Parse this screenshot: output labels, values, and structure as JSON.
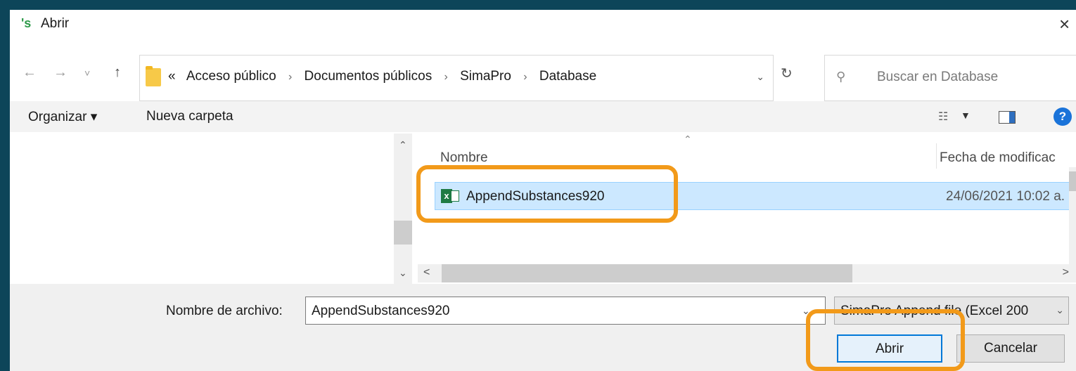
{
  "window": {
    "app_icon": "'s",
    "title": "Abrir",
    "close_glyph": "×"
  },
  "nav": {
    "back": "←",
    "forward": "→",
    "recent": "˅",
    "up": "↑",
    "breadcrumb_prefix": "«",
    "breadcrumbs": [
      "Acceso público",
      "Documentos públicos",
      "SimaPro",
      "Database"
    ],
    "separator": "›",
    "refresh": "↻",
    "search_placeholder": "Buscar en Database"
  },
  "toolbar": {
    "organize_label": "Organizar ▾",
    "new_folder_label": "Nueva carpeta",
    "help_glyph": "?"
  },
  "columns": {
    "name": "Nombre",
    "date": "Fecha de modificac"
  },
  "files": [
    {
      "name": "AppendSubstances920",
      "date": "24/06/2021 10:02 a.",
      "icon": "excel-file-icon",
      "selected": true
    }
  ],
  "footer": {
    "filename_label": "Nombre de archivo:",
    "filename_value": "AppendSubstances920",
    "filetype_value": "SimaPro Append file (Excel 200",
    "open_label": "Abrir",
    "cancel_label": "Cancelar"
  },
  "colors": {
    "background": "#0d4559",
    "highlight": "#f29a1a",
    "selection": "#cce8ff",
    "accent": "#0078d7"
  }
}
